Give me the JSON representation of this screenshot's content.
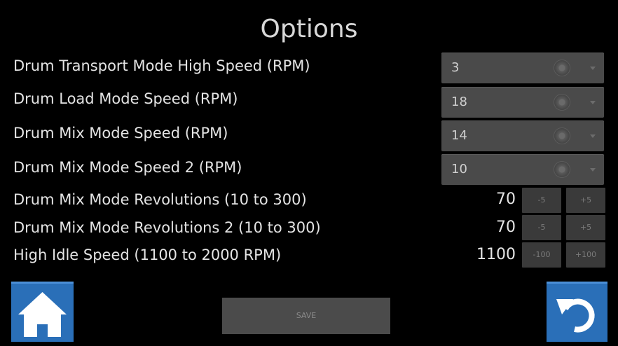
{
  "page_title": "Options",
  "settings": [
    {
      "label": "Drum Transport Mode High Speed (RPM)",
      "value": "3"
    },
    {
      "label": "Drum Load Mode Speed (RPM)",
      "value": "18"
    },
    {
      "label": "Drum Mix Mode Speed (RPM)",
      "value": "14"
    },
    {
      "label": "Drum Mix Mode Speed 2 (RPM)",
      "value": "10"
    }
  ],
  "steppers": [
    {
      "label": "Drum Mix Mode Revolutions (10 to 300)",
      "value": "70",
      "minus": "-5",
      "plus": "+5"
    },
    {
      "label": "Drum Mix Mode Revolutions 2 (10 to 300)",
      "value": "70",
      "minus": "-5",
      "plus": "+5"
    },
    {
      "label": "High Idle Speed (1100 to 2000 RPM)",
      "value": "1100",
      "minus": "-100",
      "plus": "+100"
    }
  ],
  "footer": {
    "save_label": "SAVE",
    "home_icon": "home-icon",
    "reset_icon": "undo-icon"
  },
  "colors": {
    "background": "#000000",
    "button_blue": "#2a6fb8",
    "control_gray": "#4a4a4a"
  }
}
